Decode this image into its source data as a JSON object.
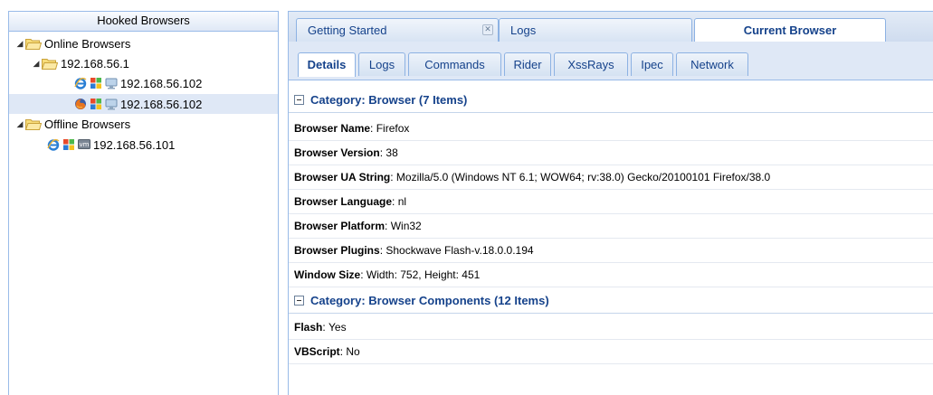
{
  "left": {
    "header": "Hooked Browsers",
    "online": {
      "label": "Online Browsers",
      "subnet": "192.168.56.1",
      "hosts": [
        {
          "ip": "192.168.56.102",
          "browser_icon": "ie-icon",
          "os_icon": "windows-icon",
          "hw_icon": "monitor-icon",
          "selected": false
        },
        {
          "ip": "192.168.56.102",
          "browser_icon": "firefox-icon",
          "os_icon": "windows-icon",
          "hw_icon": "monitor-icon",
          "selected": true
        }
      ]
    },
    "offline": {
      "label": "Offline Browsers",
      "hosts": [
        {
          "ip": "192.168.56.101",
          "browser_icon": "ie-icon",
          "os_icon": "windows-icon",
          "hw_icon": "vm-icon",
          "hw_text": "vm"
        }
      ]
    }
  },
  "main_tabs": [
    {
      "label": "Getting Started",
      "closable": true
    },
    {
      "label": "Logs",
      "closable": false
    },
    {
      "label": "Current Browser",
      "closable": false,
      "active": true
    }
  ],
  "sub_tabs": [
    "Details",
    "Logs",
    "Commands",
    "Rider",
    "XssRays",
    "Ipec",
    "Network"
  ],
  "details": {
    "category1": "Category: Browser (7 Items)",
    "rows1": [
      {
        "key": "Browser Name",
        "value": "Firefox"
      },
      {
        "key": "Browser Version",
        "value": "38"
      },
      {
        "key": "Browser UA String",
        "value": "Mozilla/5.0 (Windows NT 6.1; WOW64; rv:38.0) Gecko/20100101 Firefox/38.0"
      },
      {
        "key": "Browser Language",
        "value": "nl"
      },
      {
        "key": "Browser Platform",
        "value": "Win32"
      },
      {
        "key": "Browser Plugins",
        "value": "Shockwave Flash-v.18.0.0.194"
      },
      {
        "key": "Window Size",
        "value": "Width: 752, Height: 451"
      }
    ],
    "category2": "Category: Browser Components (12 Items)",
    "rows2": [
      {
        "key": "Flash",
        "value": "Yes"
      },
      {
        "key": "VBScript",
        "value": "No"
      }
    ]
  },
  "colors": {
    "accent": "#15428b",
    "border": "#99bbe8",
    "selected": "#dfe8f6"
  }
}
